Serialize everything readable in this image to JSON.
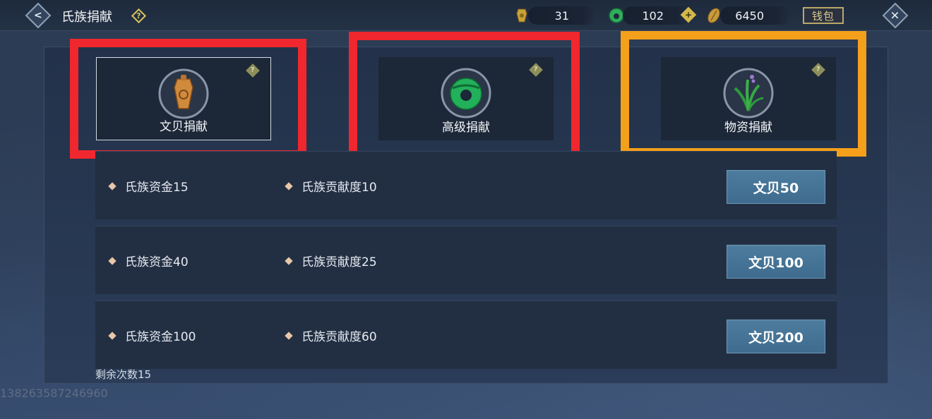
{
  "header": {
    "title": "氏族捐献",
    "back_icon": "back-arrow-icon",
    "help_icon": "help-icon",
    "currencies": [
      {
        "icon": "bronze-coin-icon",
        "value": "31"
      },
      {
        "icon": "jade-coin-icon",
        "value": "102"
      },
      {
        "icon": "shell-coin-icon",
        "value": "6450"
      }
    ],
    "wallet_label": "钱包",
    "close_icon": "close-icon",
    "plus_label": "+"
  },
  "tabs": [
    {
      "label": "文贝捐献",
      "icon": "bronze-token-icon",
      "active": true
    },
    {
      "label": "高级捐献",
      "icon": "jade-ring-icon",
      "active": false
    },
    {
      "label": "物资捐献",
      "icon": "herb-plant-icon",
      "active": false
    }
  ],
  "rows": [
    {
      "fund": "氏族资金15",
      "contribution": "氏族贡献度10",
      "cost": "文贝50"
    },
    {
      "fund": "氏族资金40",
      "contribution": "氏族贡献度25",
      "cost": "文贝100"
    },
    {
      "fund": "氏族资金100",
      "contribution": "氏族贡献度60",
      "cost": "文贝200"
    }
  ],
  "remaining_text": "剩余次数15",
  "user_id": "13826358724696​0",
  "highlight_colors": {
    "red": "#f0272e",
    "orange": "#f5a01a"
  }
}
